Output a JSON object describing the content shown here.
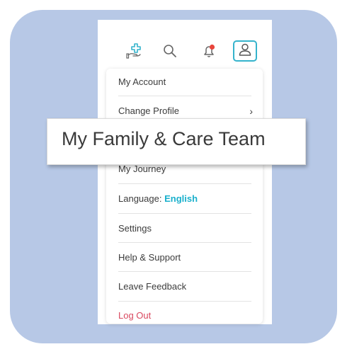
{
  "header": {
    "icons": [
      "add-care-icon",
      "search-icon",
      "notification-bell-icon",
      "profile-icon"
    ],
    "accent_color": "#35b3cc",
    "notification_dot_color": "#e8453c"
  },
  "menu": {
    "my_account": "My Account",
    "change_profile": "Change Profile",
    "my_journey": "My Journey",
    "language_label": "Language:",
    "language_value": "English",
    "settings": "Settings",
    "help_support": "Help & Support",
    "leave_feedback": "Leave Feedback",
    "log_out": "Log Out"
  },
  "callout": {
    "label": "My Family & Care Team"
  }
}
